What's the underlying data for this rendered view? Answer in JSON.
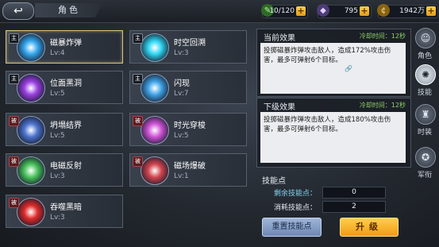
{
  "header": {
    "back_icon": "↩",
    "title": "角色"
  },
  "resources": [
    {
      "icon": "energy-icon",
      "glyph": "✎",
      "color": "#5bbd45",
      "value": "10/120"
    },
    {
      "icon": "diamond-icon",
      "glyph": "◆",
      "color": "#b58bf2",
      "value": "795"
    },
    {
      "icon": "coin-icon",
      "glyph": "¢",
      "color": "#f2b93a",
      "value": "1942万"
    }
  ],
  "skills": [
    {
      "tag": "主",
      "tag_type": "normal",
      "name": "磁暴炸弹",
      "level": "Lv:4",
      "color": "#34a7f0",
      "selected": true
    },
    {
      "tag": "主",
      "tag_type": "normal",
      "name": "时空回溯",
      "level": "Lv:3",
      "color": "#2fd6f2",
      "selected": false
    },
    {
      "tag": "主",
      "tag_type": "normal",
      "name": "位面黑洞",
      "level": "Lv:5",
      "color": "#9b3fe2",
      "selected": false
    },
    {
      "tag": "主",
      "tag_type": "normal",
      "name": "闪现",
      "level": "Lv:7",
      "color": "#3fa4e8",
      "selected": false
    },
    {
      "tag": "被",
      "tag_type": "red",
      "name": "坍塌结界",
      "level": "Lv:5",
      "color": "#4c74cf",
      "selected": false
    },
    {
      "tag": "被",
      "tag_type": "red",
      "name": "时光穿梭",
      "level": "Lv:5",
      "color": "#d054d8",
      "selected": false
    },
    {
      "tag": "被",
      "tag_type": "red",
      "name": "电磁反射",
      "level": "Lv:3",
      "color": "#49c45b",
      "selected": false
    },
    {
      "tag": "被",
      "tag_type": "red",
      "name": "磁场爆破",
      "level": "Lv:1",
      "color": "#d2454e",
      "selected": false
    },
    {
      "tag": "被",
      "tag_type": "red",
      "name": "吞噬黑暗",
      "level": "Lv:3",
      "color": "#e02a2a",
      "selected": false
    }
  ],
  "current_effect": {
    "title": "当前效果",
    "cooldown": "冷却时间：12秒",
    "description": "投掷磁暴炸弹攻击敌人，造成172%攻击伤害，最多可弹射6个目标。"
  },
  "next_effect": {
    "title": "下级效果",
    "cooldown": "冷却时间：12秒",
    "description": "投掷磁暴炸弹攻击敌人，造成180%攻击伤害，最多可弹射6个目标。"
  },
  "skill_points": {
    "title": "技能点",
    "remaining_label": "剩余技能点：",
    "remaining_value": "0",
    "cost_label": "消耗技能点：",
    "cost_value": "2"
  },
  "buttons": {
    "reset": "重置技能点",
    "upgrade": "升级"
  },
  "side_tabs": [
    {
      "icon": "role-icon",
      "glyph": "☺",
      "label": "角色",
      "active": false
    },
    {
      "icon": "skill-icon",
      "glyph": "✺",
      "label": "技能",
      "active": true
    },
    {
      "icon": "outfit-icon",
      "glyph": "♜",
      "label": "时装",
      "active": false
    },
    {
      "icon": "emblem-icon",
      "glyph": "✪",
      "label": "军衔",
      "active": false
    }
  ]
}
